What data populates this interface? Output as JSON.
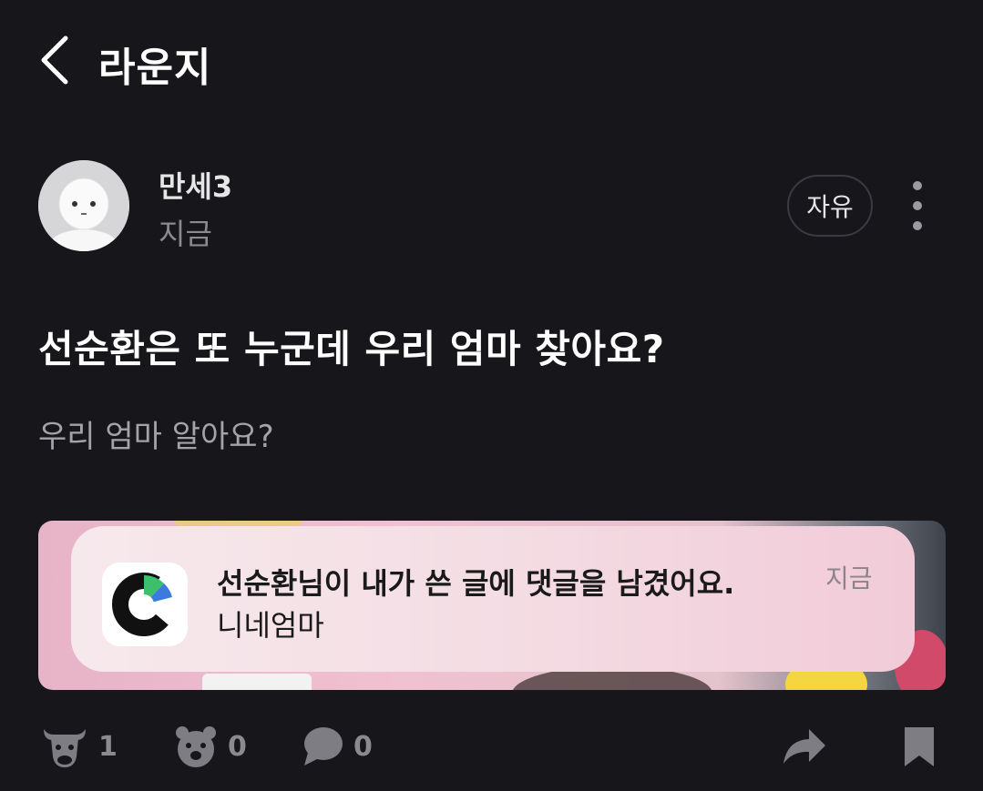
{
  "header": {
    "title": "라운지",
    "back_icon": "chevron-left-icon"
  },
  "post": {
    "author": "만세3",
    "time": "지금",
    "category": "자유",
    "title": "선순환은 또 누군데 우리 엄마 찾아요?",
    "body": "우리 엄마 알아요?"
  },
  "notification": {
    "title": "선순환님이 내가 쓴 글에 댓글을 남겼어요.",
    "body": "니네엄마",
    "time": "지금",
    "app_icon": "c-logo-icon"
  },
  "actions": {
    "bull_count": "1",
    "bear_count": "0",
    "comment_count": "0",
    "icons": [
      "bull-icon",
      "bear-icon",
      "comment-icon",
      "share-icon",
      "bookmark-icon"
    ]
  },
  "colors": {
    "background": "#16161b",
    "muted_text": "#8a8a8f",
    "icon_gray": "#7d7d83",
    "logo_green": "#3cc16a",
    "logo_blue": "#3b7be0"
  }
}
